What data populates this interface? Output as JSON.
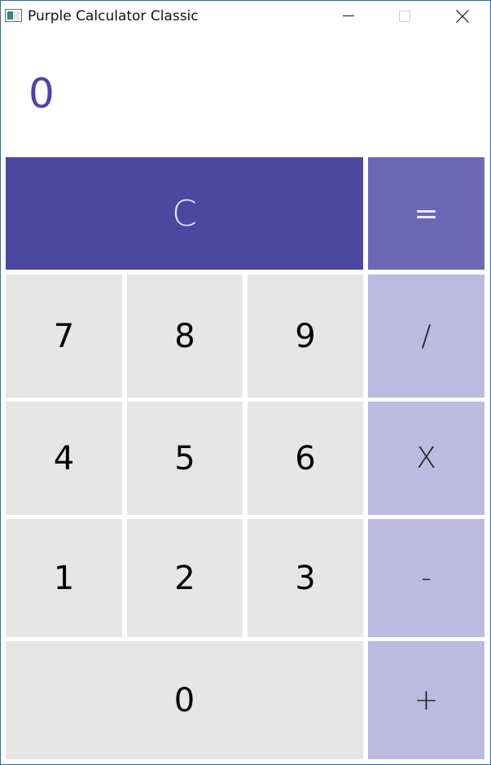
{
  "window": {
    "title": "Purple Calculator Classic",
    "icon": "app-window-icon",
    "controls": [
      "minimize-icon",
      "maximize-icon",
      "close-icon"
    ]
  },
  "display": {
    "value": "0",
    "color": "#4f44a2"
  },
  "keys": {
    "clear": "C",
    "equals": "=",
    "seven": "7",
    "eight": "8",
    "nine": "9",
    "divide": "/",
    "four": "4",
    "five": "5",
    "six": "6",
    "multiply": "X",
    "one": "1",
    "two": "2",
    "three": "3",
    "subtract": "-",
    "zero": "0",
    "add": "+"
  },
  "colors": {
    "clear_bg": "#4c47a1",
    "equals_bg": "#6c68b5",
    "operator_bg": "#bcbade",
    "number_bg": "#e6e6e6",
    "window_border": "#2d6ca8"
  }
}
